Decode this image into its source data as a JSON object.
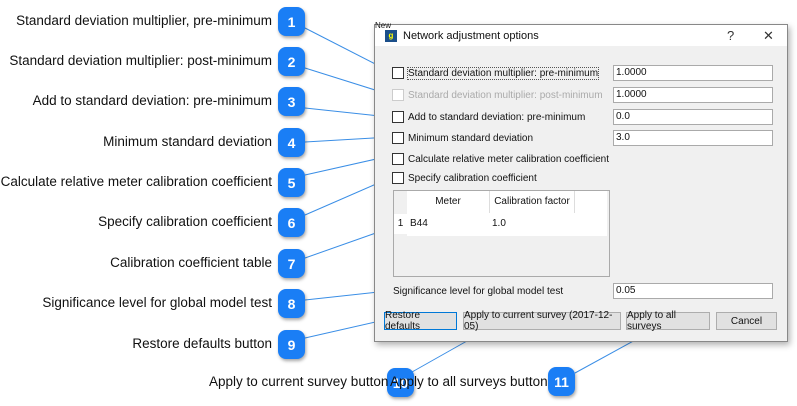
{
  "callouts": [
    {
      "n": "1",
      "label": "Standard deviation multiplier, pre-minimum"
    },
    {
      "n": "2",
      "label": "Standard deviation multiplier: post-minimum"
    },
    {
      "n": "3",
      "label": "Add to standard deviation: pre-minimum"
    },
    {
      "n": "4",
      "label": "Minimum standard deviation"
    },
    {
      "n": "5",
      "label": "Calculate relative meter calibration coefficient"
    },
    {
      "n": "6",
      "label": "Specify calibration coefficient"
    },
    {
      "n": "7",
      "label": "Calibration coefficient table"
    },
    {
      "n": "8",
      "label": "Significance level for global model test"
    },
    {
      "n": "9",
      "label": "Restore defaults button"
    },
    {
      "n": "10",
      "label": "Apply to current survey button"
    },
    {
      "n": "11",
      "label": "Apply to all surveys button"
    }
  ],
  "dialog": {
    "title": "Network adjustment options",
    "help": "?",
    "close": "✕",
    "behind_text": "New",
    "options": [
      {
        "label": "Standard deviation multiplier: pre-minimum",
        "value": "1.0000"
      },
      {
        "label": "Standard deviation multiplier: post-minimum",
        "value": "1.0000"
      },
      {
        "label": "Add to standard deviation: pre-minimum",
        "value": "0.0"
      },
      {
        "label": "Minimum standard deviation",
        "value": "3.0"
      },
      {
        "label": "Calculate relative meter calibration coefficient"
      },
      {
        "label": "Specify calibration coefficient"
      }
    ],
    "table": {
      "headers": [
        "Meter",
        "Calibration factor"
      ],
      "rows": [
        {
          "index": "1",
          "meter": "B44",
          "factor": "1.0"
        }
      ]
    },
    "significance": {
      "label": "Significance level for global model test",
      "value": "0.05"
    },
    "buttons": {
      "restore": "Restore defaults",
      "apply_current": "Apply to current survey (2017-12-05)",
      "apply_all": "Apply to all surveys",
      "cancel": "Cancel"
    }
  },
  "colors": {
    "badge": "#1a7ef5",
    "line": "#3a8ee6"
  }
}
